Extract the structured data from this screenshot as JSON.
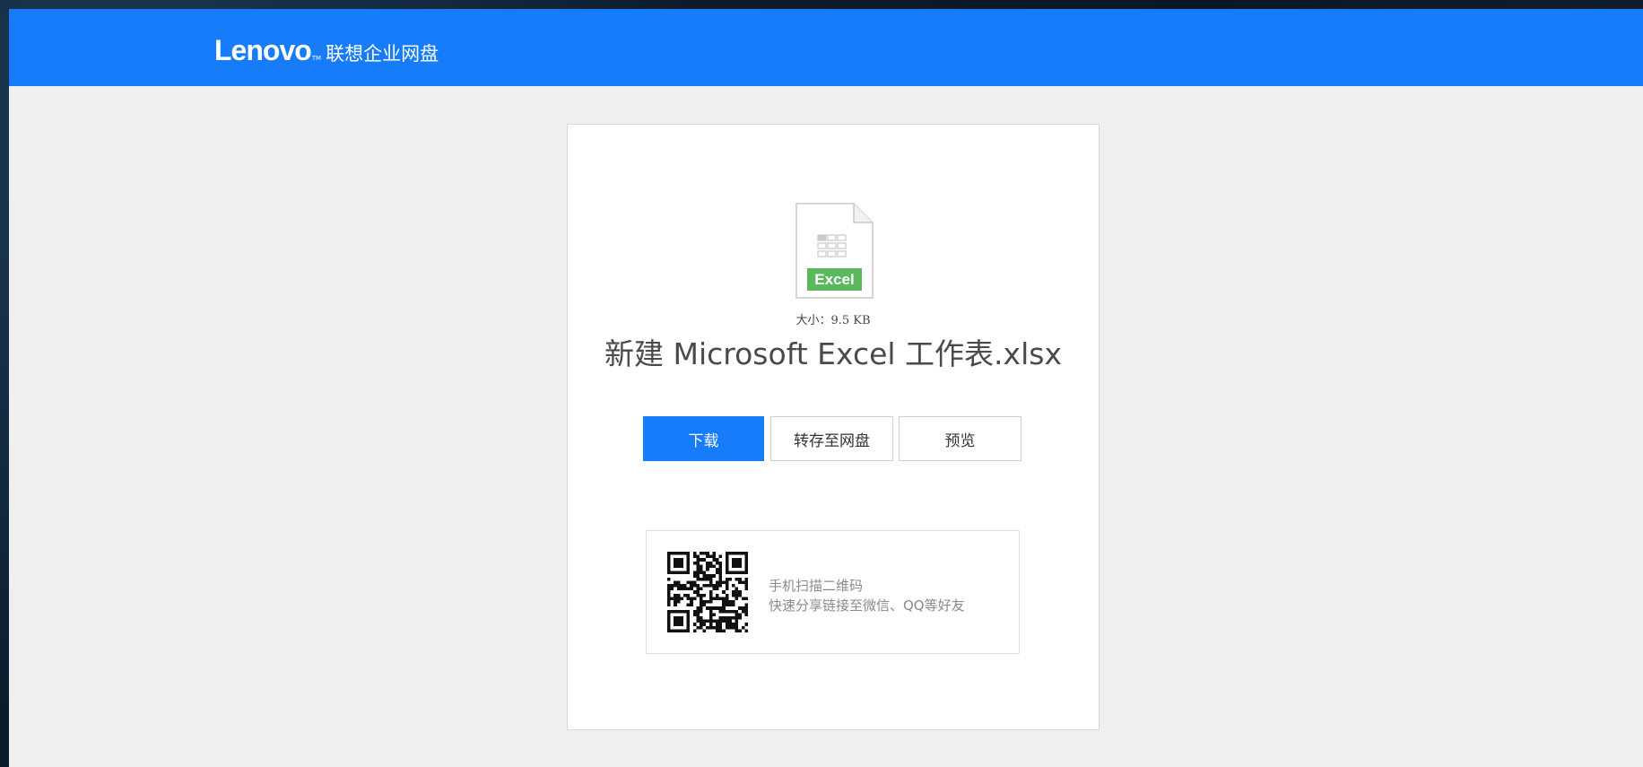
{
  "header": {
    "logo_text": "Lenovo",
    "logo_tm": "TM",
    "product_name": "联想企业网盘",
    "bar_color": "#167cf9"
  },
  "file": {
    "type_badge": "Excel",
    "type_badge_color": "#5cb85c",
    "icon": "excel-file-icon",
    "size_text": "大小：9.5 KB",
    "name": "新建 Microsoft Excel 工作表.xlsx"
  },
  "actions": {
    "download_label": "下载",
    "save_to_drive_label": "转存至网盘",
    "preview_label": "预览",
    "accent_color": "#167cf9"
  },
  "share": {
    "qr_icon": "qr-code-icon",
    "line1": "手机扫描二维码",
    "line2": "快速分享链接至微信、QQ等好友"
  }
}
